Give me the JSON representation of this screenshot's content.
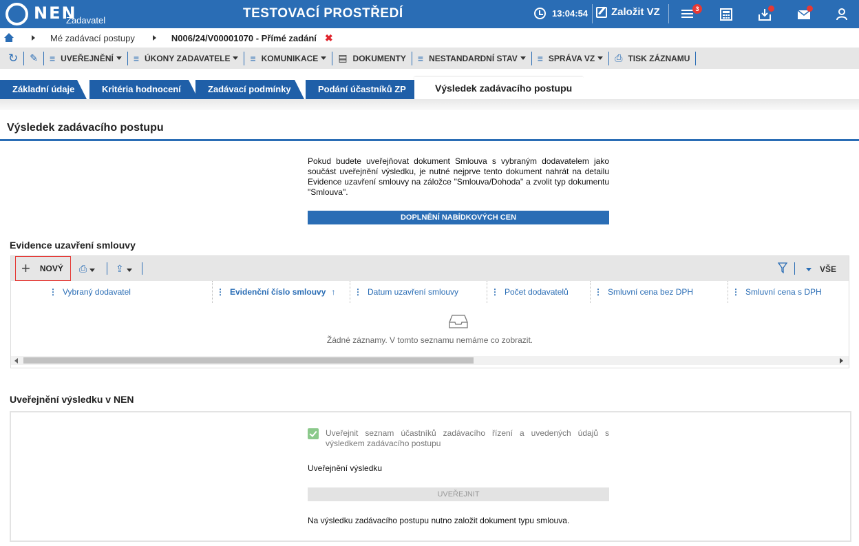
{
  "header": {
    "logo_text": "NEN",
    "logo_sub": "Zadavatel",
    "env_title": "TESTOVACÍ PROSTŘEDÍ",
    "time": "13:04:54",
    "new_vz_label": "Založit VZ",
    "notification_count": "3"
  },
  "breadcrumb": {
    "item1": "Mé zadávací postupy",
    "item2": "N006/24/V00001070 - Přímé zadání"
  },
  "toolbar": {
    "uverejneni": "UVEŘEJNĚNÍ",
    "ukony": "ÚKONY ZADAVATELE",
    "komunikace": "KOMUNIKACE",
    "dokumenty": "DOKUMENTY",
    "nestandardni": "NESTANDARDNÍ STAV",
    "sprava": "SPRÁVA VZ",
    "tisk": "TISK ZÁZNAMU"
  },
  "tabs": [
    {
      "label": "Základní údaje"
    },
    {
      "label": "Kritéria hodnocení"
    },
    {
      "label": "Zadávací podmínky"
    },
    {
      "label": "Podání účastníků ZP"
    },
    {
      "label": "Výsledek zadávacího postupu"
    }
  ],
  "page": {
    "title": "Výsledek zadávacího postupu",
    "info": "Pokud budete uveřejňovat dokument Smlouva s vybraným dodavatelem jako součást uveřejnění výsledku, je nutné nejprve tento dokument nahrát na detailu Evidence uzavření smlouvy na záložce \"Smlouva/Dohoda\" a zvolit typ dokumentu \"Smlouva\".",
    "fill_button": "DOPLNĚNÍ NABÍDKOVÝCH CEN"
  },
  "contract_section": {
    "title": "Evidence uzavření smlouvy",
    "new_button": "NOVÝ",
    "filter_all": "VŠE",
    "columns": [
      "Vybraný dodavatel",
      "Evidenční číslo smlouvy",
      "Datum uzavření smlouvy",
      "Počet dodavatelů",
      "Smluvní cena bez DPH",
      "Smluvní cena s DPH"
    ],
    "empty_text": "Žádné záznamy. V tomto seznamu nemáme co zobrazit."
  },
  "publication_section": {
    "title": "Uveřejnění výsledku v NEN",
    "checkbox_label": "Uveřejnit seznam účastníků zadávacího řízení a uvedených údajů s výsledkem zadávacího postupu",
    "checkbox_checked": true,
    "result_label": "Uveřejnění výsledku",
    "publish_button": "UVEŘEJNIT",
    "note": "Na výsledku zadávacího postupu nutno založit dokument typu smlouva."
  },
  "colors": {
    "brand_blue": "#2a6db5",
    "tab_blue": "#1f5fa8",
    "alert_red": "#e53935"
  }
}
